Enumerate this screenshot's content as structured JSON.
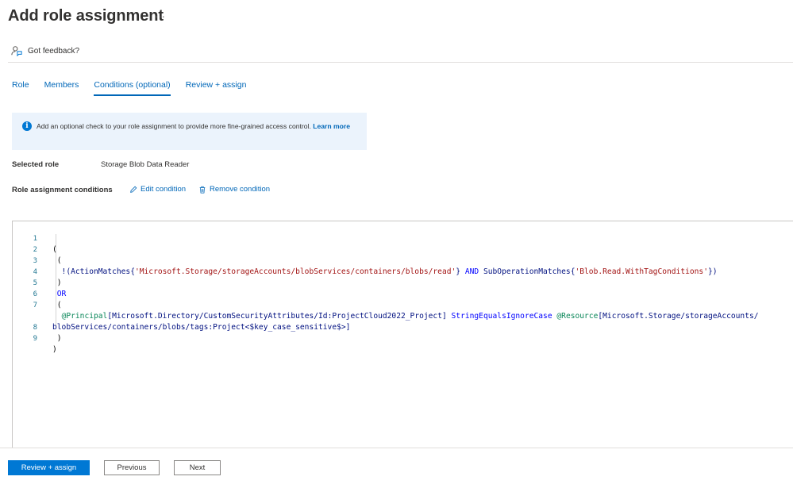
{
  "header": {
    "title": "Add role assignment",
    "more": "···"
  },
  "feedback": {
    "label": "Got feedback?",
    "icon": "feedback-icon"
  },
  "tabs": [
    {
      "label": "Role",
      "active": false
    },
    {
      "label": "Members",
      "active": false
    },
    {
      "label": "Conditions (optional)",
      "active": true
    },
    {
      "label": "Review + assign",
      "active": false
    }
  ],
  "info": {
    "icon": "info-icon",
    "text": "Add an optional check to your role assignment to provide more fine-grained access control.",
    "link": "Learn more"
  },
  "selected_role": {
    "label": "Selected role",
    "value": "Storage Blob Data Reader"
  },
  "conditions": {
    "label": "Role assignment conditions",
    "edit_label": "Edit condition",
    "remove_label": "Remove condition"
  },
  "editor": {
    "line_numbers": [
      "1",
      "2",
      "3",
      "4",
      "5",
      "6",
      "7",
      "",
      "8",
      "9"
    ],
    "lines": [
      "(",
      " (",
      "  !(ActionMatches{'Microsoft.Storage/storageAccounts/blobServices/containers/blobs/read'} AND SubOperationMatches{'Blob.Read.WithTagConditions'})",
      " )",
      " OR",
      " (",
      "  @Principal[Microsoft.Directory/CustomSecurityAttributes/Id:ProjectCloud2022_Project] StringEqualsIgnoreCase @Resource[Microsoft.Storage/storageAccounts/",
      "blobServices/containers/blobs/tags:Project<$key_case_sensitive$>]",
      " )",
      ")"
    ]
  },
  "footer": {
    "primary_label": "Review + assign",
    "previous_label": "Previous",
    "next_label": "Next"
  },
  "colors": {
    "accent": "#0078d4",
    "info_bg": "#ebf3fc"
  }
}
